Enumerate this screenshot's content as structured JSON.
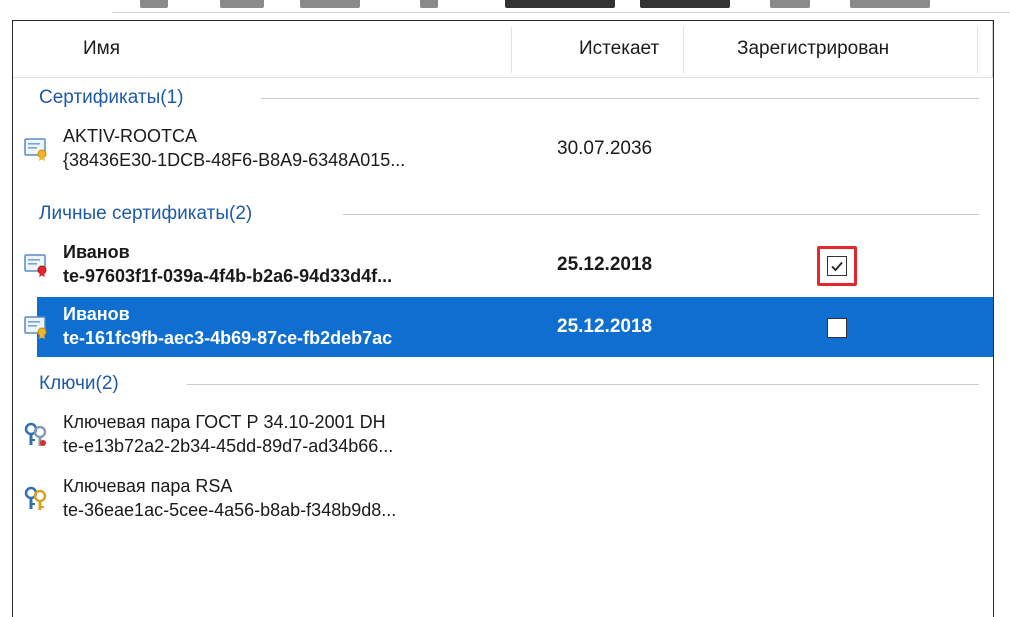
{
  "columns": {
    "name": "Имя",
    "expires": "Истекает",
    "registered": "Зарегистрирован"
  },
  "groups": [
    {
      "label": "Сертификаты(1)",
      "items": [
        {
          "name": "AKTIV-ROOTCA",
          "sub": "{38436E30-1DCB-48F6-B8A9-6348A015...",
          "expires": "30.07.2036",
          "icon": "certificate-icon"
        }
      ]
    },
    {
      "label": "Личные сертификаты(2)",
      "items": [
        {
          "name": "Иванов",
          "sub": "te-97603f1f-039a-4f4b-b2a6-94d33d4f...",
          "expires": "25.12.2018",
          "icon": "personal-certificate-icon",
          "registered": true,
          "highlighted": true
        },
        {
          "name": "Иванов",
          "sub": "te-161fc9fb-aec3-4b69-87ce-fb2deb7ac",
          "expires": "25.12.2018",
          "icon": "certificate-icon",
          "registered": false,
          "selected": true
        }
      ]
    },
    {
      "label": "Ключи(2)",
      "items": [
        {
          "name": "Ключевая пара ГОСТ Р 34.10-2001 DH",
          "sub": "te-e13b72a2-2b34-45dd-89d7-ad34b66...",
          "icon": "key-pair-icon"
        },
        {
          "name": "Ключевая пара RSA",
          "sub": "te-36eae1ac-5cee-4a56-b8ab-f348b9d8...",
          "icon": "key-pair-icon"
        }
      ]
    }
  ],
  "colors": {
    "selection": "#0e6fd1",
    "group_label": "#1e5aa8",
    "highlight": "#e0282e"
  }
}
